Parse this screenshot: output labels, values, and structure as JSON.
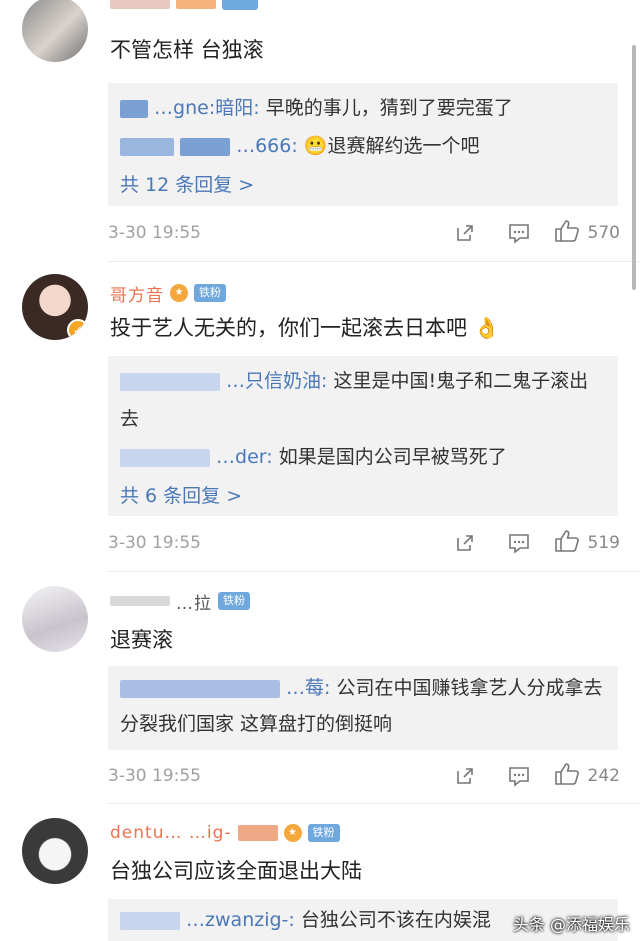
{
  "comments": [
    {
      "name": "",
      "text": "不管怎样 台独滚",
      "replies": [
        {
          "user": "…gne:暗阳:",
          "text": "早晚的事儿，猜到了要完蛋了"
        },
        {
          "user": "…666:",
          "text": "😬退赛解约选一个吧"
        }
      ],
      "more": "共 12 条回复 >",
      "time": "3-30 19:55",
      "likes": "570"
    },
    {
      "name": "哥方音",
      "badge": "铁粉",
      "text": "投于艺人无关的，你们一起滚去日本吧 👌",
      "replies": [
        {
          "user": "…只信奶油:",
          "text": "这里是中国!鬼子和二鬼子滚出去"
        },
        {
          "user": "…der:",
          "text": "如果是国内公司早被骂死了"
        }
      ],
      "more": "共 6 条回复 >",
      "time": "3-30 19:55",
      "likes": "519"
    },
    {
      "name": "…拉",
      "badge": "铁粉",
      "text": "退赛滚",
      "replies": [
        {
          "user": "…莓:",
          "text": "公司在中国赚钱拿艺人分成拿去分裂我们国家 这算盘打的倒挺响"
        }
      ],
      "time": "3-30 19:55",
      "likes": "242"
    },
    {
      "name": "dentu… …ig-",
      "badge": "铁粉",
      "text": "台独公司应该全面退出大陆",
      "replies": [
        {
          "user": "…zwanzig-:",
          "text": "台独公司不该在内娱混"
        }
      ]
    }
  ],
  "icons": {
    "share": "share-icon",
    "comment": "comment-icon",
    "like": "like-icon",
    "verified": "verified-badge-icon"
  },
  "watermark": "头条 @添福娱乐",
  "colors": {
    "name": "#eb7350",
    "link": "#4a78b8",
    "badge": "#6fa8dc",
    "reply_bg": "#f2f2f2"
  }
}
